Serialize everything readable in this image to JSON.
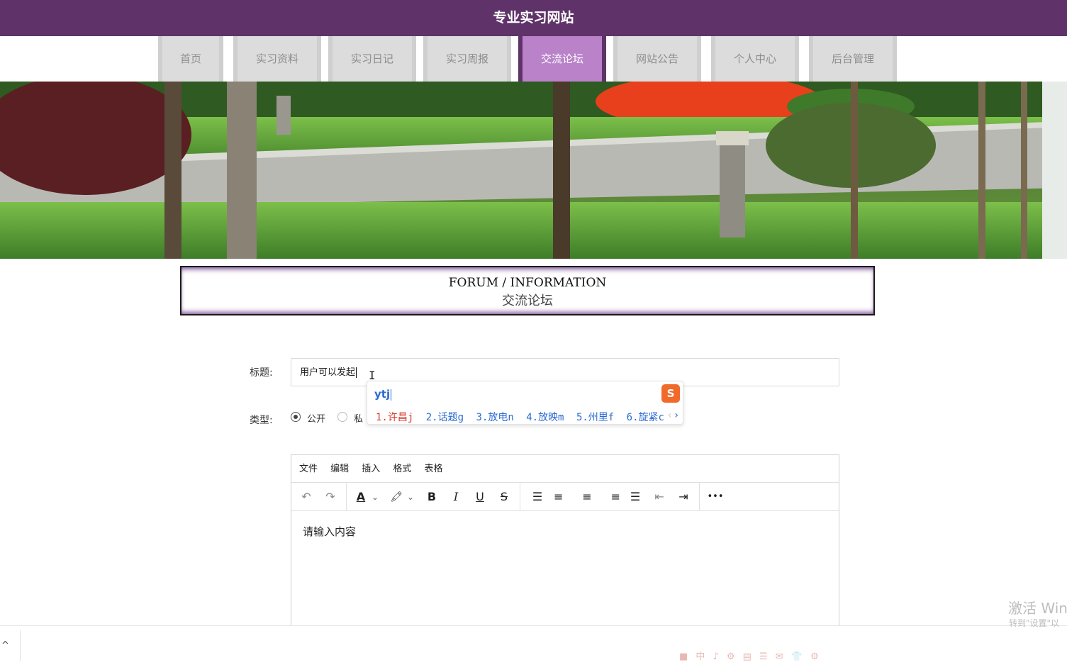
{
  "header": {
    "title": "专业实习网站"
  },
  "nav": {
    "items": [
      {
        "label": "首页"
      },
      {
        "label": "实习资料"
      },
      {
        "label": "实习日记"
      },
      {
        "label": "实习周报"
      },
      {
        "label": "交流论坛"
      },
      {
        "label": "网站公告"
      },
      {
        "label": "个人中心"
      },
      {
        "label": "后台管理"
      }
    ],
    "active_label": "交流论坛",
    "active_color": "#b982c9",
    "bar_color": "#5f3369"
  },
  "section": {
    "title_en": "FORUM / INFORMATION",
    "title_cn": "交流论坛"
  },
  "form": {
    "title_label": "标题:",
    "title_value": "用户可以发起",
    "type_label": "类型:",
    "type_options": [
      {
        "label": "公开",
        "checked": true
      },
      {
        "label": "私",
        "checked": false
      }
    ]
  },
  "ime": {
    "input": "ytj",
    "candidates": [
      "1.许昌j",
      "2.话题g",
      "3.放电n",
      "4.放映m",
      "5.州里f",
      "6.旋紧c"
    ],
    "logo_icon": "sogou-logo-icon"
  },
  "editor": {
    "menu": [
      "文件",
      "编辑",
      "插入",
      "格式",
      "表格"
    ],
    "toolbar": {
      "undo": "↶",
      "redo": "↷",
      "font_color": "A",
      "dropdown": "⌄",
      "highlight": "🖍",
      "bold": "B",
      "italic": "I",
      "underline": "U",
      "strikethrough": "S",
      "line_height": "☰",
      "align_left": "≡",
      "align_center": "≡",
      "align_right": "≡",
      "justify": "☰",
      "outdent": "⇤",
      "indent": "⇥",
      "more": "•••"
    },
    "placeholder": "请输入内容"
  },
  "watermark": {
    "title": "激活 Win",
    "subtitle": "转到\"设置\"以"
  },
  "ime_tray": [
    "中",
    "♪",
    "⚙",
    "▤",
    "☰",
    "✉",
    "👕",
    "⚙"
  ]
}
